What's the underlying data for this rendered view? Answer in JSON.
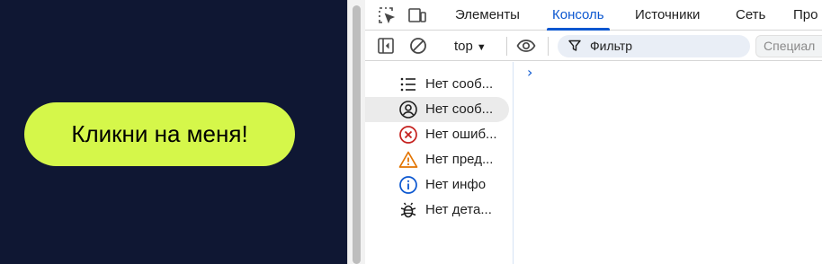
{
  "page": {
    "button_label": "Кликни на меня!"
  },
  "devtools": {
    "tabs": [
      {
        "label": "Элементы"
      },
      {
        "label": "Консоль"
      },
      {
        "label": "Источники"
      },
      {
        "label": "Сеть"
      },
      {
        "label": "Про"
      }
    ],
    "active_tab": "Консоль",
    "toolbar": {
      "context": "top",
      "filter_placeholder": "Фильтр",
      "levels_label": "Специал"
    },
    "sidebar": {
      "items": [
        {
          "label": "Нет сооб...",
          "icon": "list-icon"
        },
        {
          "label": "Нет сооб...",
          "icon": "user-icon"
        },
        {
          "label": "Нет ошиб...",
          "icon": "error-icon"
        },
        {
          "label": "Нет пред...",
          "icon": "warning-icon"
        },
        {
          "label": "Нет инфо",
          "icon": "info-icon"
        },
        {
          "label": "Нет дета...",
          "icon": "bug-icon"
        }
      ]
    },
    "console": {
      "prompt": "›"
    }
  },
  "colors": {
    "page_bg": "#0f1733",
    "button_bg": "#d5f74a",
    "accent": "#0b57d0",
    "error": "#c5221f",
    "warning": "#e37400"
  }
}
